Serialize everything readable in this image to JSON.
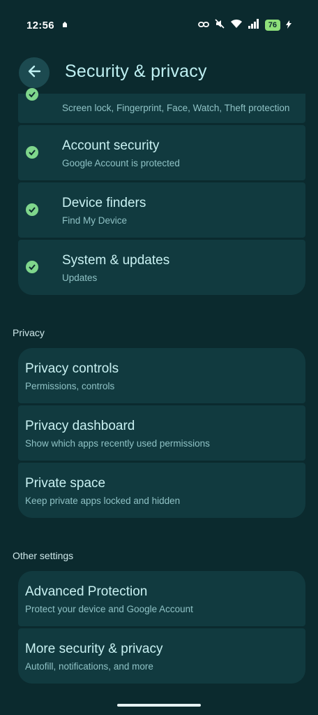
{
  "status": {
    "time": "12:56",
    "battery": "76"
  },
  "header": {
    "title": "Security & privacy"
  },
  "security_items": [
    {
      "title": "",
      "subtitle": "Screen lock, Fingerprint, Face, Watch, Theft protection"
    },
    {
      "title": "Account security",
      "subtitle": "Google Account is protected"
    },
    {
      "title": "Device finders",
      "subtitle": "Find My Device"
    },
    {
      "title": "System & updates",
      "subtitle": "Updates"
    }
  ],
  "privacy": {
    "label": "Privacy",
    "items": [
      {
        "title": "Privacy controls",
        "subtitle": "Permissions, controls"
      },
      {
        "title": "Privacy dashboard",
        "subtitle": "Show which apps recently used permissions"
      },
      {
        "title": "Private space",
        "subtitle": "Keep private apps locked and hidden"
      }
    ]
  },
  "other": {
    "label": "Other settings",
    "items": [
      {
        "title": "Advanced Protection",
        "subtitle": "Protect your device and Google Account"
      },
      {
        "title": "More security & privacy",
        "subtitle": "Autofill, notifications, and more"
      }
    ]
  },
  "colors": {
    "accent": "#bff0f2",
    "check": "#7fd68c",
    "card": "#113a3f",
    "background": "#0b2a2e"
  }
}
